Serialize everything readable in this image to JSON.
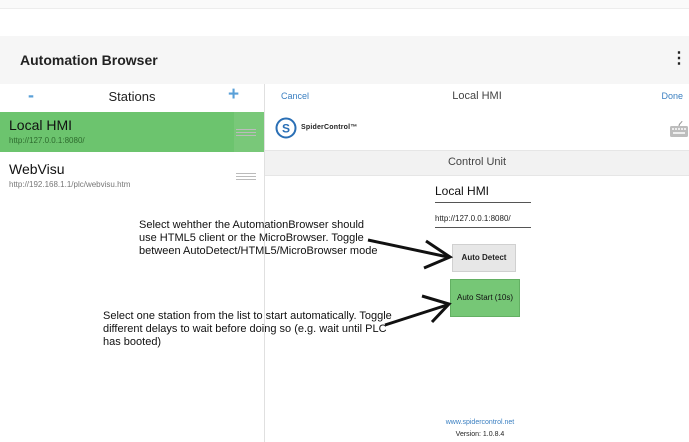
{
  "app": {
    "title": "Automation Browser",
    "menu_glyph": "⋮"
  },
  "stations_panel": {
    "title": "Stations",
    "minus_label": "-",
    "plus_label": "+",
    "items": [
      {
        "name": "Local HMI",
        "url": "http://127.0.0.1:8080/",
        "selected": true
      },
      {
        "name": "WebVisu",
        "url": "http://192.168.1.1/plc/webvisu.htm",
        "selected": false
      }
    ]
  },
  "detail_panel": {
    "cancel_label": "Cancel",
    "title": "Local HMI",
    "done_label": "Done",
    "logo_text": "SpiderControl™",
    "section_title": "Control Unit",
    "name_value": "Local HMI",
    "url_value": "http://127.0.0.1:8080/",
    "auto_detect_label": "Auto Detect",
    "auto_start_label": "Auto Start (10s)",
    "website": "www.spidercontrol.net",
    "version": "Version: 1.0.8.4"
  },
  "annotations": {
    "client_mode": "Select wehther the AutomationBrowser should use HTML5 client or the MicroBrowser. Toggle between AutoDetect/HTML5/MicroBrowser mode",
    "auto_start": "Select one station from the list to start automatically. Toggle different delays to wait before doing so (e.g. wait until PLC has booted)"
  },
  "colors": {
    "selected_green": "#6cc46e",
    "link_blue": "#3a7fc1",
    "accent_blue": "#5aa0d8"
  }
}
